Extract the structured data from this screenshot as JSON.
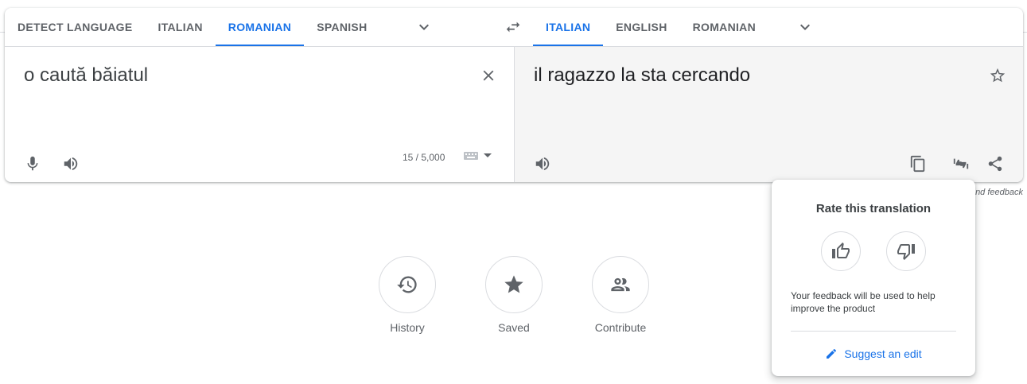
{
  "source_langs": [
    "DETECT LANGUAGE",
    "ITALIAN",
    "ROMANIAN",
    "SPANISH"
  ],
  "source_active": "ROMANIAN",
  "target_langs": [
    "ITALIAN",
    "ENGLISH",
    "ROMANIAN"
  ],
  "target_active": "ITALIAN",
  "source": {
    "text": "o caută băiatul",
    "char_count": "15 / 5,000"
  },
  "target": {
    "text": "il ragazzo la sta cercando"
  },
  "feedback_hint": "Send feedback",
  "quick_links": {
    "history": "History",
    "saved": "Saved",
    "contribute": "Contribute"
  },
  "rate_popup": {
    "title": "Rate this translation",
    "note": "Your feedback will be used to help improve the product",
    "suggest": "Suggest an edit"
  },
  "colors": {
    "accent": "#1a73e8",
    "icon": "#5f6368",
    "target_bg": "#f5f5f5"
  },
  "icons": [
    "chevron-down-icon",
    "swap-icon",
    "close-icon",
    "star-icon",
    "mic-icon",
    "speaker-icon",
    "keyboard-icon",
    "copy-icon",
    "thumbs-rate-icon",
    "share-icon",
    "history-icon",
    "saved-star-icon",
    "people-icon",
    "thumb-up-icon",
    "thumb-down-icon",
    "pencil-icon"
  ]
}
